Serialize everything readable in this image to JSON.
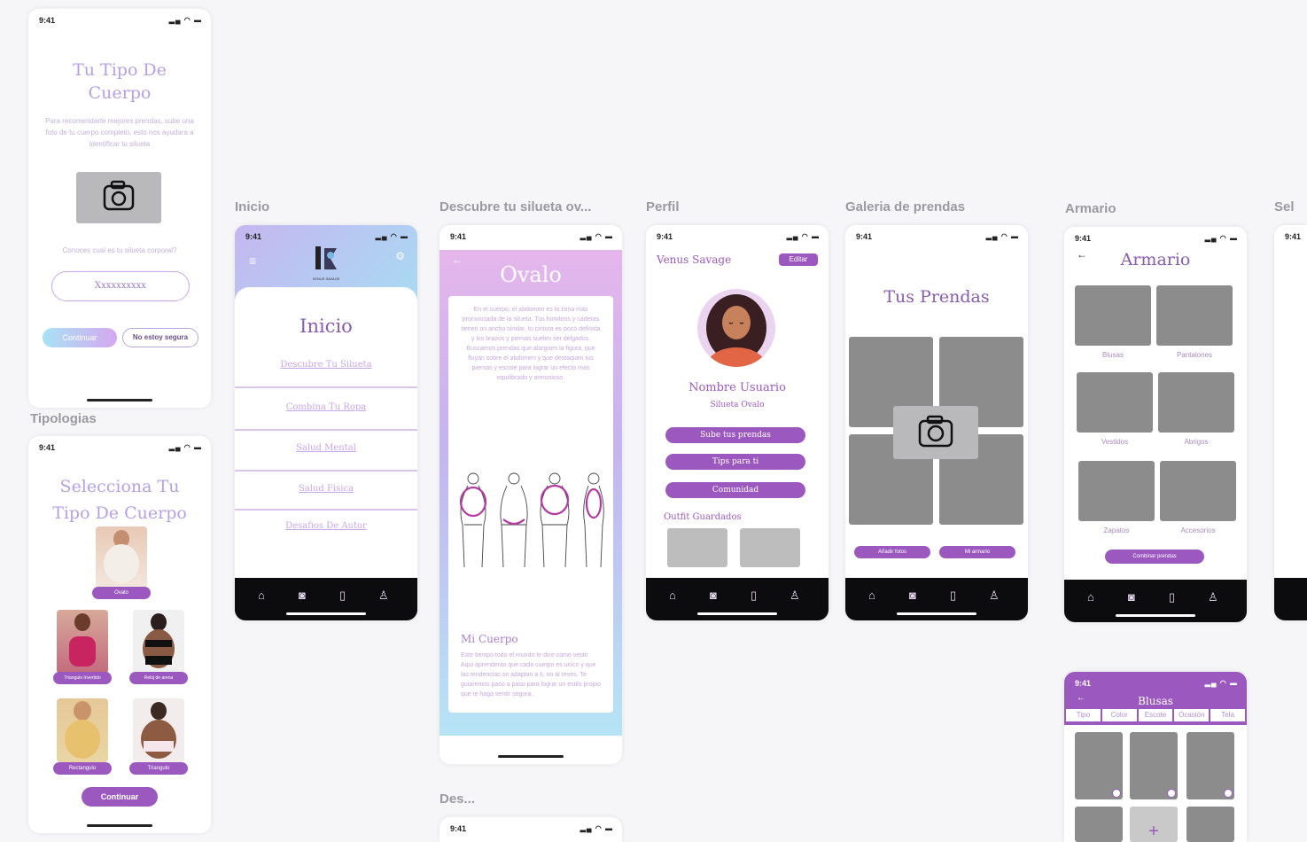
{
  "status_time": "9:41",
  "labels": {
    "inicio": "Inicio",
    "descubre": "Descubre tu silueta ov...",
    "perfil": "Perfil",
    "galeria": "Galeria de prendas",
    "armario": "Armario",
    "sel": "Sel",
    "tipologias": "Tipologias",
    "des": "Des..."
  },
  "tipo_cuerpo": {
    "title_line1": "Tu Tipo De",
    "title_line2": "Cuerpo",
    "desc": "Para recomendarte mejores prendas, sube una foto de tu cuerpo completo, esto nos ayudara a identificar tu silueta",
    "hint": "Conoces cual es tu silueta corporal?",
    "input_value": "Xxxxxxxxxx",
    "btn_continue": "Continuar",
    "btn_unsure": "No estoy segura"
  },
  "tipologias": {
    "title_line1": "Selecciona Tu",
    "title_line2": "Tipo De Cuerpo",
    "items": [
      "Ovalo",
      "Triangulo Invertido",
      "Reloj de arena",
      "Rectangulo",
      "Triangulo"
    ],
    "btn": "Continuar"
  },
  "inicio": {
    "logo_sub": "VENUS SAVAGE",
    "title": "Inicio",
    "menu": [
      "Descubre Tu Silueta",
      "Combina Tu Ropa",
      "Salud Mental",
      "Salud Fisica",
      "Desafios De Autor"
    ]
  },
  "ovalo": {
    "title": "Ovalo",
    "body": "En el cuerpo, el abdomen es la zona mas pronunciada de la silueta. Tus hombros y caderas tienen un ancho similar, tu cintura es poco definida y los brazos y piernas suelen ser delgados. Buscamos prendas que alarguen la figura, que fluyan sobre el abdomen y que destaquen tus piernas y escote para lograr un efecto mas equilibrado y armonioso.",
    "subtitle": "Mi Cuerpo",
    "body2": "Este tiempo todo el mundo te dice como vestir. Aqui aprenderas que cada cuerpo es unico y que las tendencias se adaptan a ti, no al reves. Te guiaremos paso a paso para lograr un estilo propio que te haga sentir segura."
  },
  "perfil": {
    "name": "Venus Savage",
    "edit": "Editar",
    "username": "Nombre Usuario",
    "silueta": "Silueta Ovalo",
    "buttons": [
      "Sube tus prendas",
      "Tips para ti",
      "Comunidad"
    ],
    "outfits": "Outfit Guardados"
  },
  "galeria": {
    "title": "Tus Prendas",
    "btn1": "Añadir fotos",
    "btn2": "Mi armario"
  },
  "armario": {
    "title": "Armario",
    "items": [
      "Blusas",
      "Pantalones",
      "Vestidos",
      "Abrigos",
      "Zapatos",
      "Accesorios"
    ],
    "btn": "Combinar prendas"
  },
  "blusas": {
    "title": "Blusas",
    "filters": [
      "Tipo",
      "Color",
      "Escote",
      "Ocasión",
      "Tela"
    ]
  },
  "colors": {
    "purple": "#9b59c0",
    "lilac": "#c9a6e8",
    "black": "#0c0c0e",
    "gray": "#8c8c8c"
  }
}
